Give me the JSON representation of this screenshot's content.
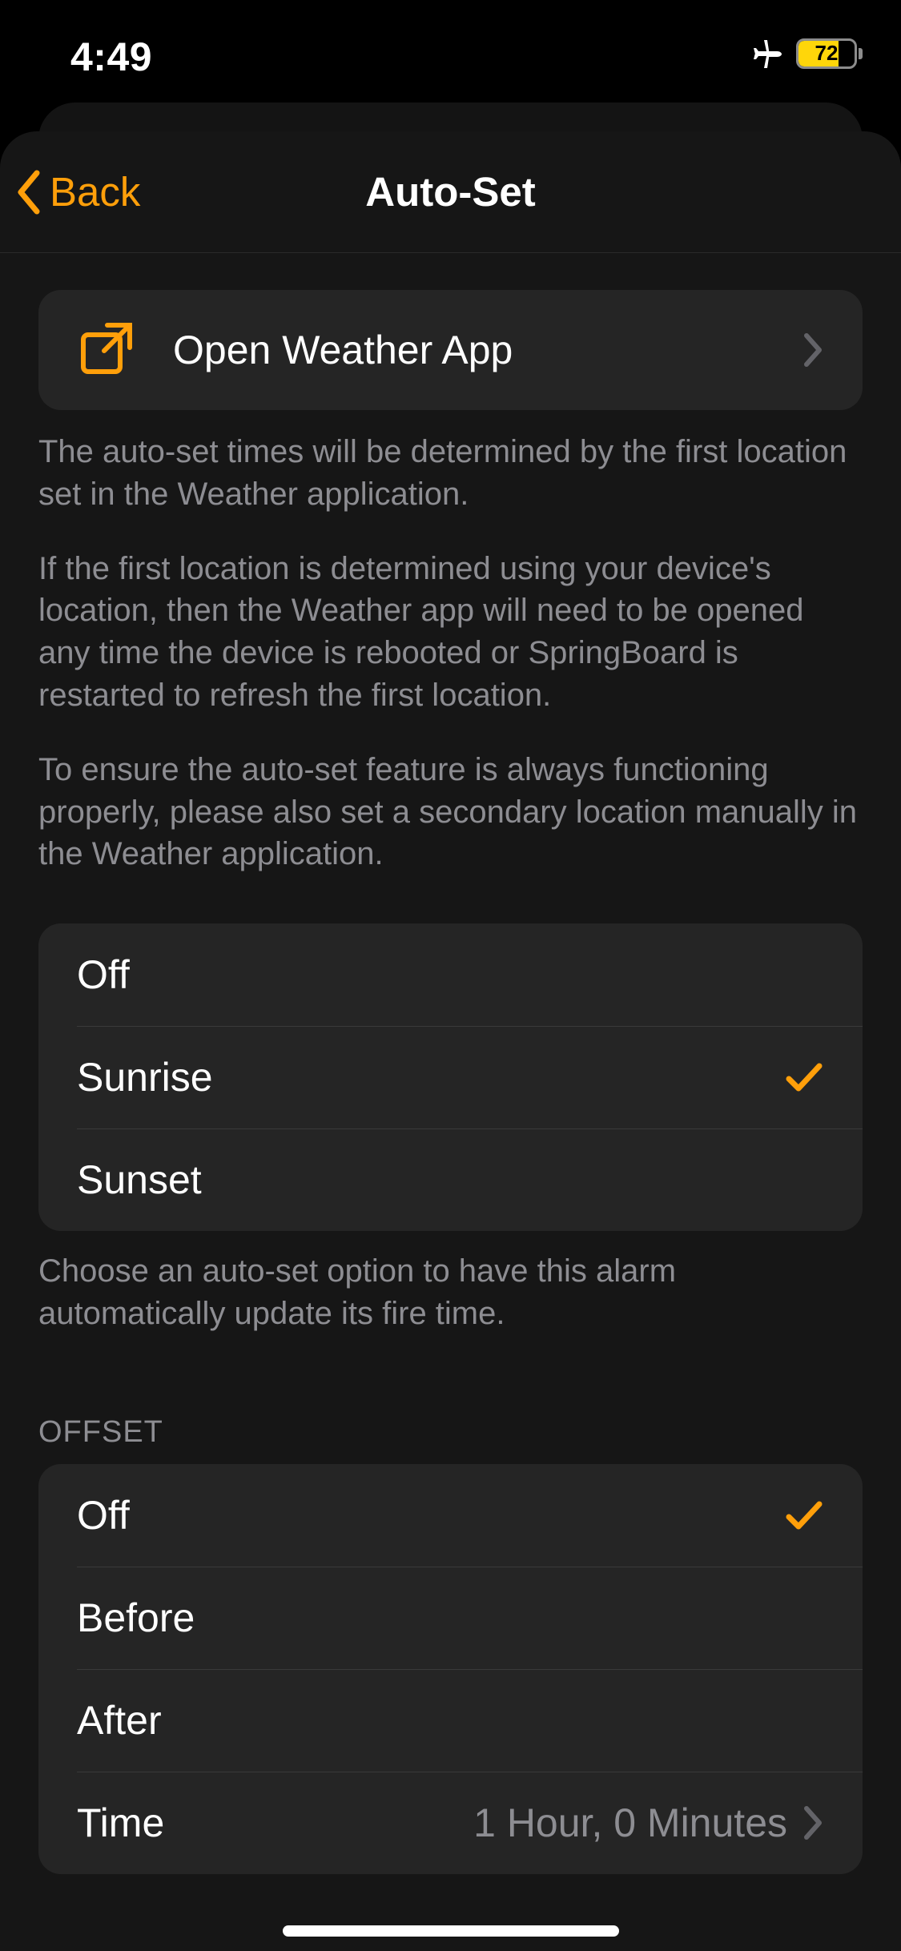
{
  "statusBar": {
    "time": "4:49",
    "batteryPercent": "72"
  },
  "nav": {
    "backLabel": "Back",
    "title": "Auto-Set"
  },
  "openWeather": {
    "label": "Open Weather App"
  },
  "description": {
    "p1": "The auto-set times will be determined by the first location set in the Weather application.",
    "p2": "If the first location is determined using your device's location, then the Weather app will need to be opened any time the device is rebooted or SpringBoard is restarted to refresh the first location.",
    "p3": "To ensure the auto-set feature is always functioning properly, please also set a secondary location manually in the Weather application."
  },
  "autosetOptions": {
    "off": "Off",
    "sunrise": "Sunrise",
    "sunset": "Sunset",
    "footer": "Choose an auto-set option to have this alarm automatically update its fire time."
  },
  "offset": {
    "header": "OFFSET",
    "off": "Off",
    "before": "Before",
    "after": "After",
    "timeLabel": "Time",
    "timeValue": "1 Hour, 0 Minutes"
  }
}
